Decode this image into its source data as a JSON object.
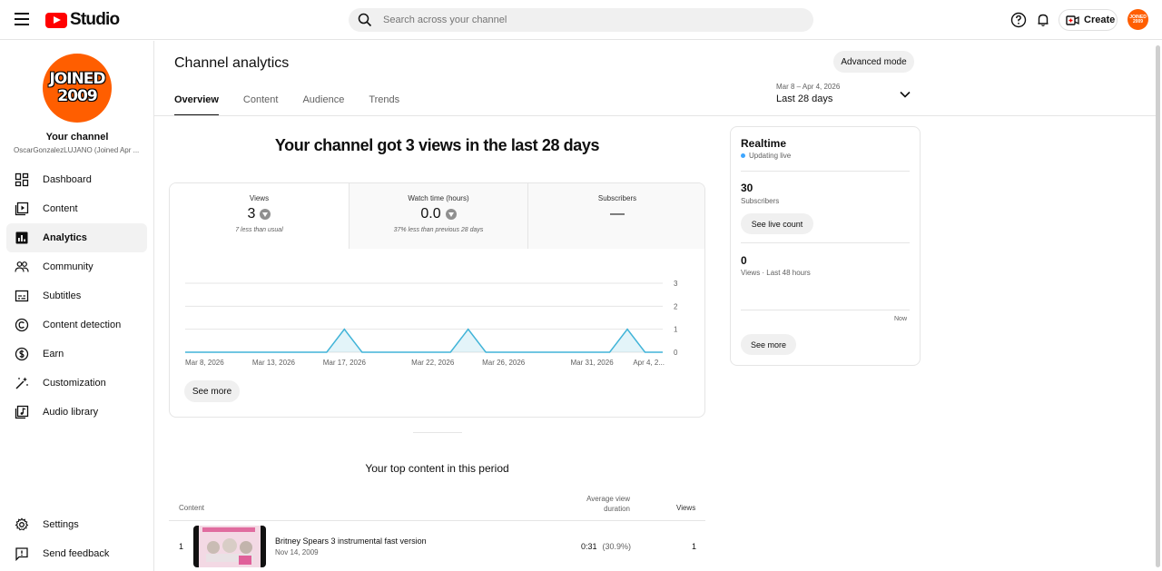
{
  "header": {
    "logo_text": "Studio",
    "search_placeholder": "Search across your channel",
    "create_label": "Create",
    "avatar_text": "JOINED 2009"
  },
  "sidebar": {
    "avatar_line1": "JOINED",
    "avatar_line2": "2009",
    "channel_title": "Your channel",
    "channel_sub": "OscarGonzalezLUJANO (Joined Apr ...",
    "items": [
      {
        "label": "Dashboard",
        "icon": "dashboard-icon"
      },
      {
        "label": "Content",
        "icon": "content-icon"
      },
      {
        "label": "Analytics",
        "icon": "analytics-icon",
        "active": true
      },
      {
        "label": "Community",
        "icon": "community-icon"
      },
      {
        "label": "Subtitles",
        "icon": "subtitles-icon"
      },
      {
        "label": "Content detection",
        "icon": "copyright-icon"
      },
      {
        "label": "Earn",
        "icon": "dollar-icon"
      },
      {
        "label": "Customization",
        "icon": "magic-wand-icon"
      },
      {
        "label": "Audio library",
        "icon": "audio-library-icon"
      }
    ],
    "bottom_items": [
      {
        "label": "Settings",
        "icon": "gear-icon"
      },
      {
        "label": "Send feedback",
        "icon": "feedback-icon"
      }
    ]
  },
  "main": {
    "title": "Channel analytics",
    "advanced_mode": "Advanced mode",
    "tabs": [
      "Overview",
      "Content",
      "Audience",
      "Trends"
    ],
    "active_tab": "Overview",
    "date_range_dates": "Mar 8 – Apr 4, 2026",
    "date_range_label": "Last 28 days",
    "headline": "Your channel got 3 views in the last 28 days",
    "metrics": [
      {
        "label": "Views",
        "value": "3",
        "note": "7 less than usual",
        "trend": "down"
      },
      {
        "label": "Watch time (hours)",
        "value": "0.0",
        "note": "37% less than previous 28 days",
        "trend": "down"
      },
      {
        "label": "Subscribers",
        "value": "—",
        "note": "",
        "trend": "none"
      }
    ],
    "see_more": "See more"
  },
  "chart_data": {
    "type": "area",
    "title": "",
    "xlabel": "",
    "ylabel": "",
    "x": [
      "Mar 8, 2026",
      "Mar 9",
      "Mar 10",
      "Mar 11",
      "Mar 12",
      "Mar 13, 2026",
      "Mar 14",
      "Mar 15",
      "Mar 16",
      "Mar 17, 2026",
      "Mar 18",
      "Mar 19",
      "Mar 20",
      "Mar 21",
      "Mar 22, 2026",
      "Mar 23",
      "Mar 24",
      "Mar 25",
      "Mar 26, 2026",
      "Mar 27",
      "Mar 28",
      "Mar 29",
      "Mar 30",
      "Mar 31, 2026",
      "Apr 1",
      "Apr 2",
      "Apr 3",
      "Apr 4, 2..."
    ],
    "values": [
      0,
      0,
      0,
      0,
      0,
      0,
      0,
      0,
      0,
      1,
      0,
      0,
      0,
      0,
      0,
      0,
      1,
      0,
      0,
      0,
      0,
      0,
      0,
      0,
      0,
      1,
      0,
      0
    ],
    "tick_labels": [
      "Mar 8, 2026",
      "Mar 13, 2026",
      "Mar 17, 2026",
      "Mar 22, 2026",
      "Mar 26, 2026",
      "Mar 31, 2026",
      "Apr 4, 2..."
    ],
    "tick_indices": [
      0,
      5,
      9,
      14,
      18,
      23,
      27
    ],
    "y_ticks": [
      "0",
      "1",
      "2",
      "3"
    ],
    "ylim": [
      0,
      3
    ],
    "grid": true,
    "color": "#41b4d8"
  },
  "realtime": {
    "title": "Realtime",
    "live": "Updating live",
    "subs_count": "30",
    "subs_label": "Subscribers",
    "live_count_btn": "See live count",
    "views_count": "0",
    "views_label": "Views · Last 48 hours",
    "now": "Now",
    "see_more": "See more"
  },
  "top_content": {
    "title": "Your top content in this period",
    "col_content": "Content",
    "col_avd_1": "Average view",
    "col_avd_2": "duration",
    "col_views": "Views",
    "rows": [
      {
        "rank": "1",
        "title": "Britney Spears 3 instrumental fast version",
        "date": "Nov 14, 2009",
        "duration": "0:31",
        "pct": "(30.9%)",
        "views": "1"
      }
    ]
  }
}
